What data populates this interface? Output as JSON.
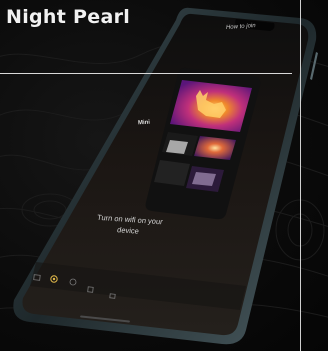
{
  "brand": {
    "title": "Night Pearl"
  },
  "screen": {
    "header_title": "How to join",
    "instruction_line1": "Turn on wifi on your",
    "instruction_line2": "device",
    "card_label": "Mini"
  },
  "colors": {
    "background": "#0b0b0b",
    "phone_frame": "#2b3a3f",
    "screen_bg": "#141414",
    "thermal_magenta": "#9b1fa8",
    "thermal_orange": "#f08a2a",
    "nav_accent": "#e0b84a"
  },
  "icons": {
    "nav": [
      "gallery-icon",
      "home-icon",
      "camera-icon",
      "settings-icon",
      "more-icon"
    ]
  }
}
